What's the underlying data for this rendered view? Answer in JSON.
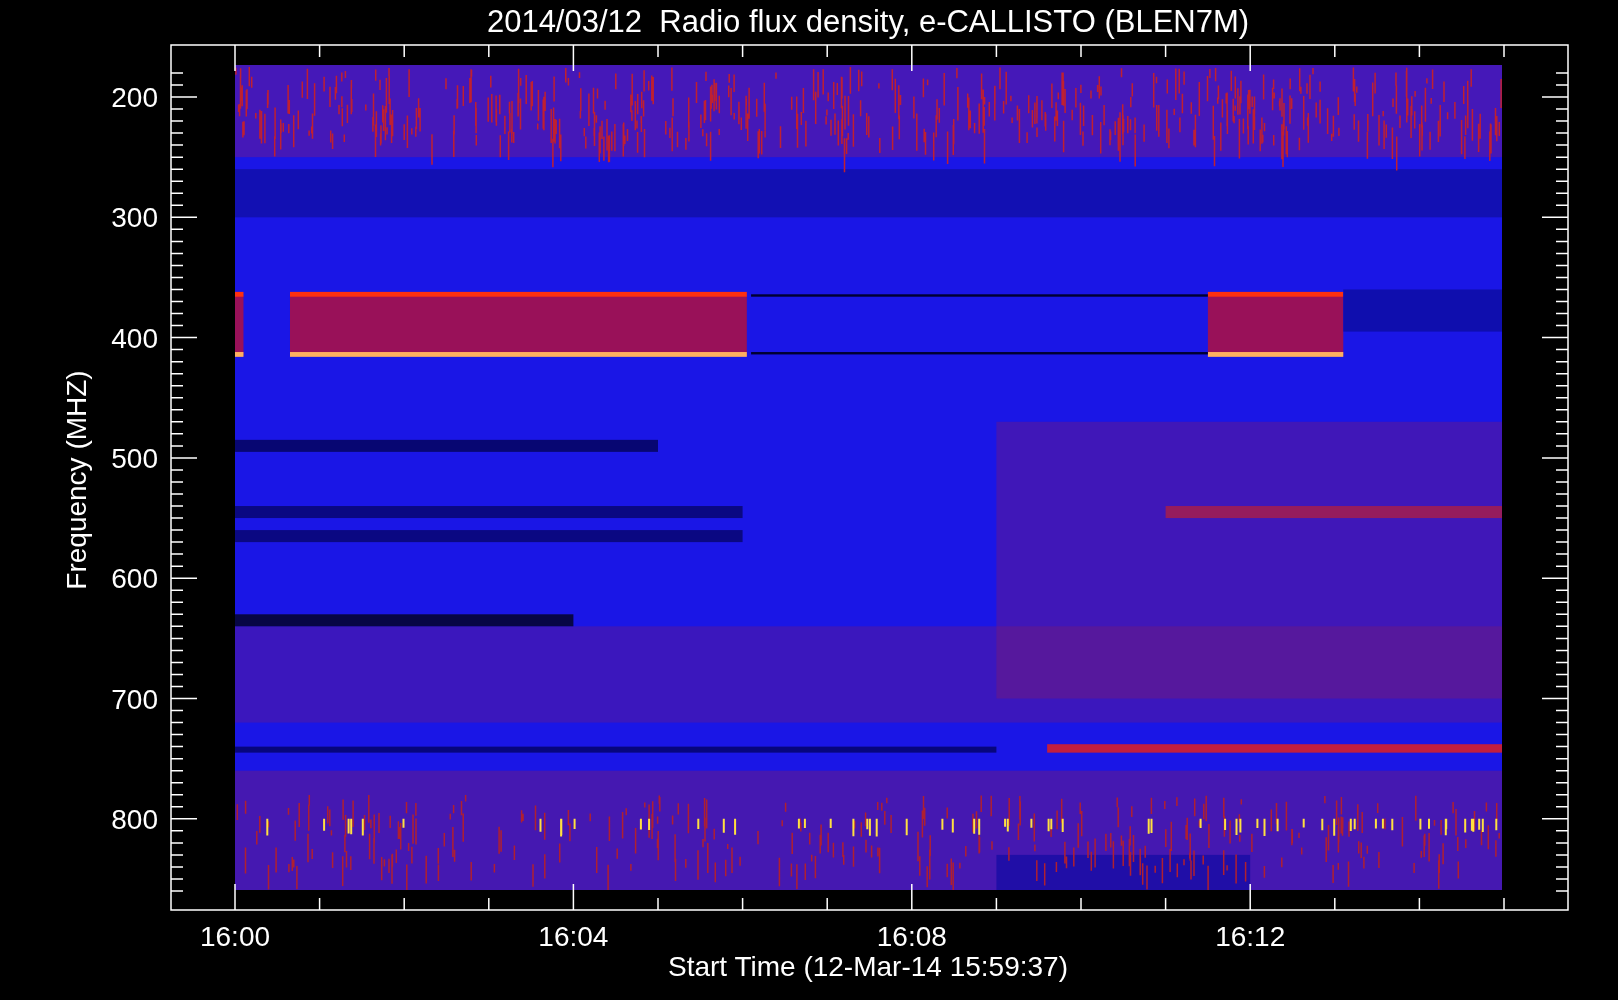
{
  "plot": {
    "title": "2014/03/12  Radio flux density, e-CALLISTO (BLEN7M)",
    "ylabel": "Frequency (MHZ)",
    "yticks": [
      "200",
      "300",
      "400",
      "500",
      "600",
      "700",
      "800"
    ],
    "xticks": [
      "16:00",
      "16:04",
      "16:08",
      "16:12"
    ],
    "xlabel": "Start Time (12-Mar-14 15:59:37)"
  }
}
